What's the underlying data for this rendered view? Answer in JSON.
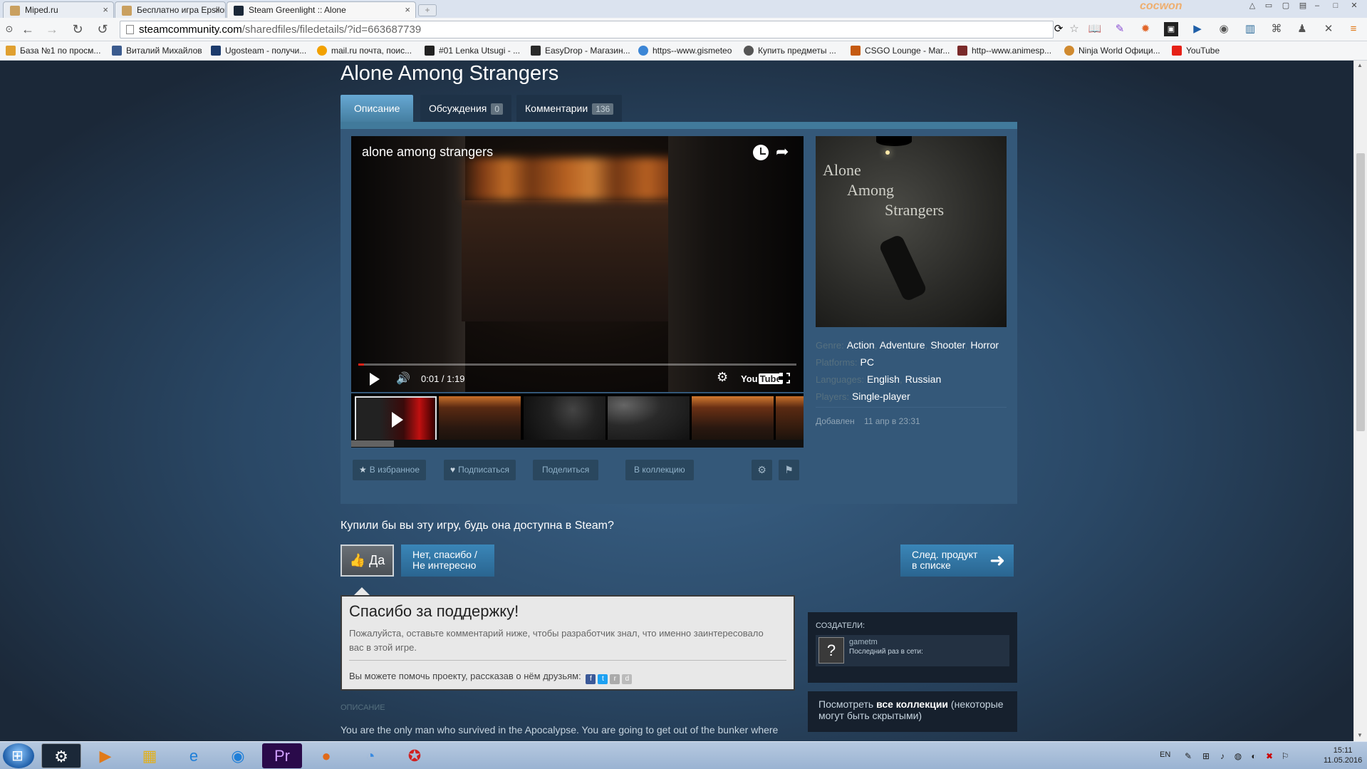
{
  "browser": {
    "tabs": [
      {
        "title": "Miped.ru",
        "active": false
      },
      {
        "title": "Бесплатно игра Epsilon c",
        "active": false
      },
      {
        "title": "Steam Greenlight :: Alone",
        "active": true
      }
    ],
    "brand_overlay": "cocwon",
    "url": {
      "host": "steamcommunity.com",
      "path": "/sharedfiles/filedetails/?id=663687739"
    },
    "bookmarks": [
      "База №1 по просм...",
      "Виталий Михайлов",
      "Ugosteam - получи...",
      "mail.ru почта, поис...",
      "#01 Lenka Utsugi - ...",
      "EasyDrop - Магазин...",
      "https--www.gismeteo",
      "Купить предметы ...",
      "CSGO Lounge - Mar...",
      "http--www.animesp...",
      "Ninja World Офици...",
      "YouTube"
    ]
  },
  "page": {
    "title": "Alone Among Strangers",
    "tabs": [
      {
        "label": "Описание",
        "count": null
      },
      {
        "label": "Обсуждения",
        "count": "0"
      },
      {
        "label": "Комментарии",
        "count": "136"
      }
    ],
    "video": {
      "title": "alone among strangers",
      "time": "0:01 / 1:19",
      "progress": 0.013,
      "youtube_label": "You",
      "youtube_label2": "Tube"
    },
    "actions": {
      "favorite": "В избранное",
      "subscribe": "Подписаться",
      "share": "Поделиться",
      "collection": "В коллекцию"
    },
    "capsule_text": [
      "Alone",
      "Among",
      "Strangers"
    ],
    "meta": {
      "genre_label": "Genre:",
      "genres": [
        "Action",
        "Adventure",
        "Shooter",
        "Horror"
      ],
      "platforms_label": "Platforms:",
      "platforms": [
        "PC"
      ],
      "languages_label": "Languages:",
      "languages": [
        "English",
        "Russian"
      ],
      "players_label": "Players:",
      "players": [
        "Single-player"
      ],
      "added_label": "Добавлен",
      "added_value": "11 апр в 23:31"
    },
    "vote": {
      "question": "Купили бы вы эту игру, будь она доступна в Steam?",
      "yes": "Да",
      "no_line1": "Нет, спасибо /",
      "no_line2": "Не интересно",
      "next_line1": "След. продукт",
      "next_line2": "в списке"
    },
    "thanks": {
      "heading": "Спасибо за поддержку!",
      "text": "Пожалуйста, оставьте комментарий ниже, чтобы разработчик знал, что именно заинтересовало вас в этой игре.",
      "share_text": "Вы можете помочь проекту, рассказав о нём друзьям:"
    },
    "description": {
      "heading": "ОПИСАНИЕ",
      "text": "You are the only man who survived in the Apocalypse. You are going to get out of the bunker where"
    },
    "creators": {
      "heading": "СОЗДАТЕЛИ:",
      "name": "gametm",
      "last_online": "Последний раз в сети:"
    },
    "collections": {
      "prefix": "Посмотреть ",
      "link": "все коллекции",
      "suffix": " (некоторые могут быть скрытыми)"
    }
  },
  "taskbar": {
    "lang": "EN",
    "time": "15:11",
    "date": "11.05.2016"
  }
}
